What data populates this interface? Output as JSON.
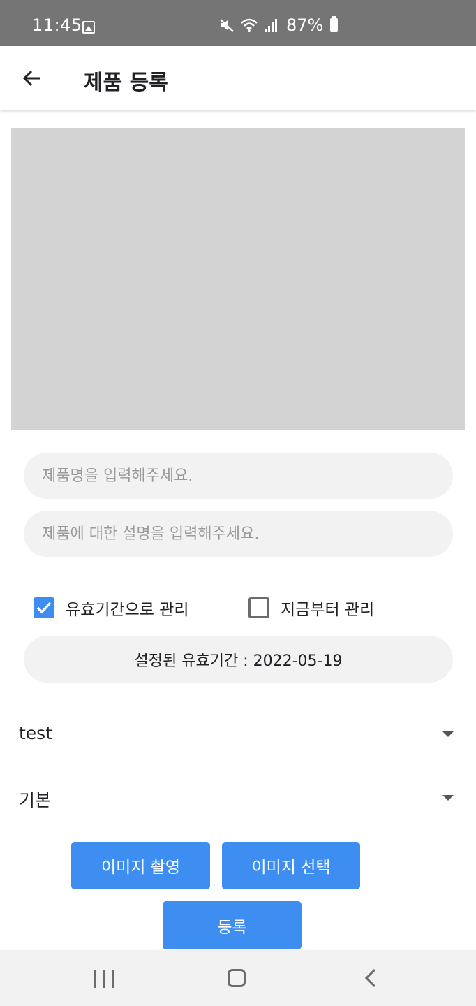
{
  "status_bar": {
    "time": "11:45",
    "battery": "87%",
    "icons": [
      "gallery-icon",
      "mute-icon",
      "wifi-icon",
      "signal-icon",
      "battery-icon"
    ]
  },
  "app_bar": {
    "title": "제품 등록",
    "back_icon": "arrow-left-icon"
  },
  "form": {
    "name_placeholder": "제품명을 입력해주세요.",
    "name_value": "",
    "description_placeholder": "제품에 대한 설명을 입력해주세요.",
    "description_value": "",
    "checkbox_expiry": {
      "label": "유효기간으로 관리",
      "checked": true
    },
    "checkbox_from_now": {
      "label": "지금부터 관리",
      "checked": false
    },
    "expiry_text": "설정된 유효기간 : 2022-05-19",
    "dropdown_1": {
      "selected": "test"
    },
    "dropdown_2": {
      "selected": "기본"
    }
  },
  "buttons": {
    "capture_image": "이미지 촬영",
    "select_image": "이미지 선택",
    "register": "등록"
  },
  "colors": {
    "accent": "#3d8ef0",
    "status_bar": "#757575",
    "placeholder_bg": "#d3d3d3",
    "input_bg": "#f2f2f2"
  },
  "nav_bar": {
    "icons": [
      "recent-apps-icon",
      "home-icon",
      "back-icon"
    ]
  }
}
